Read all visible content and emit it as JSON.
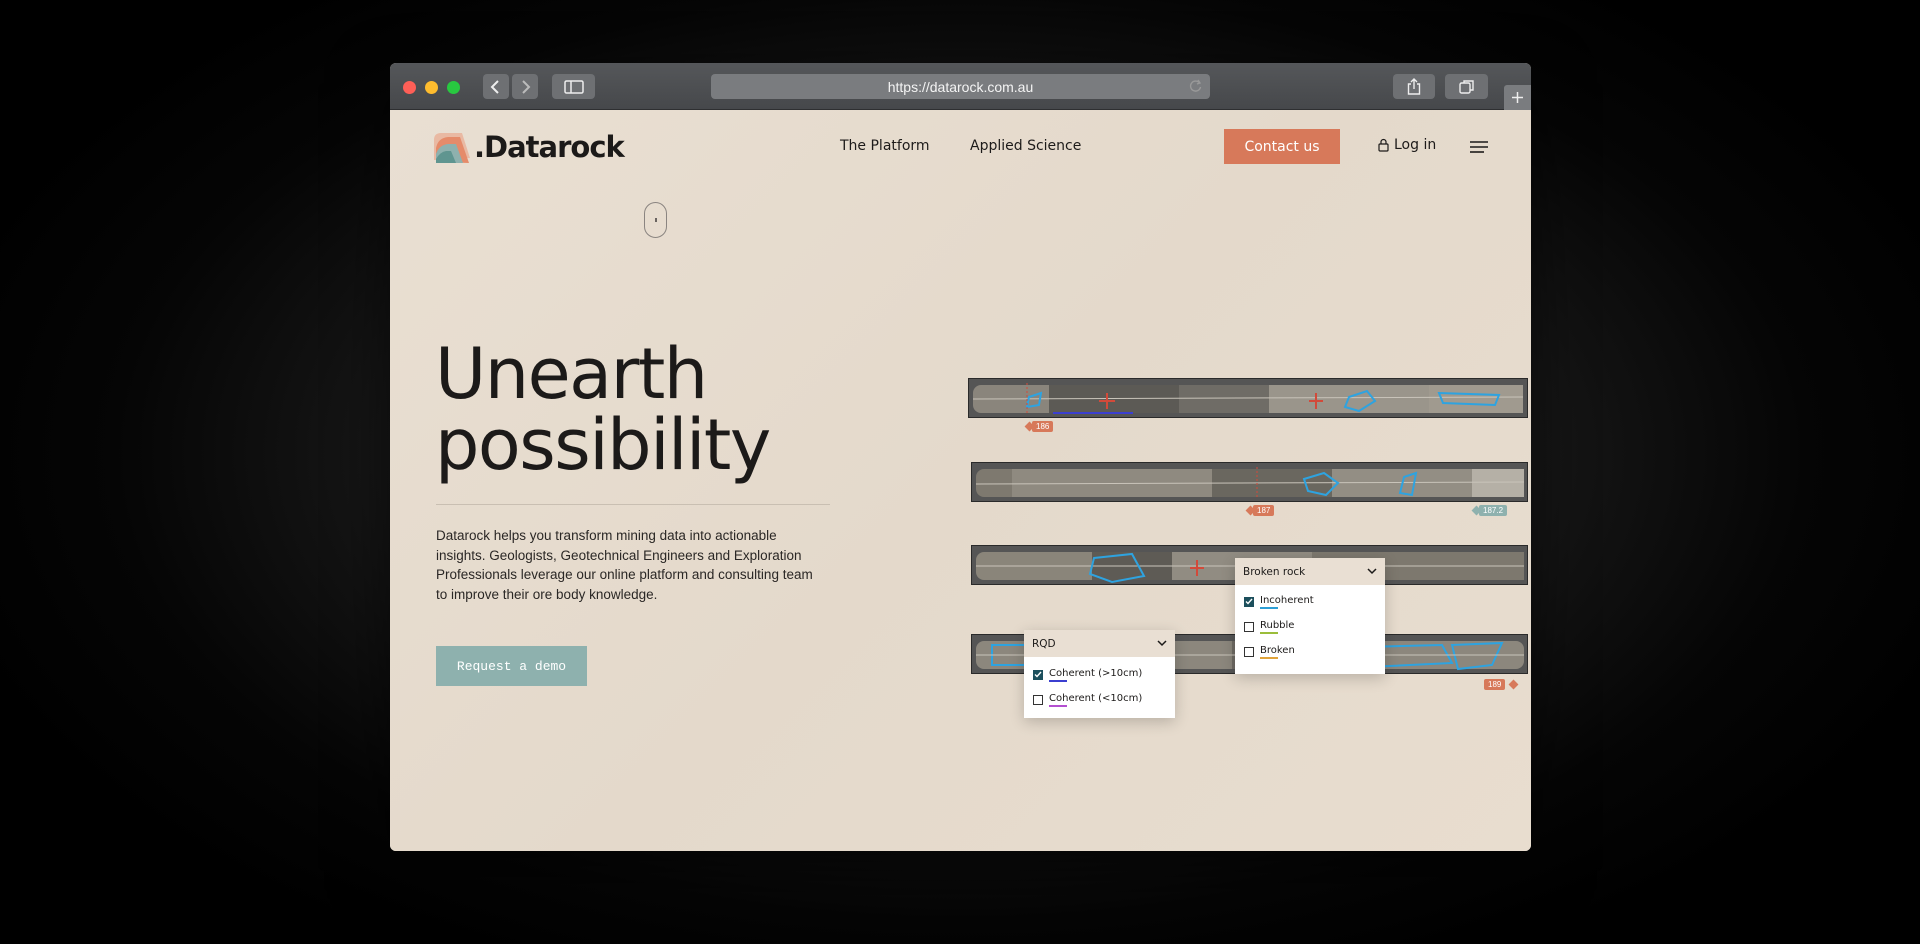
{
  "browser": {
    "url": "https://datarock.com.au"
  },
  "header": {
    "logo_text": ".Datarock",
    "nav": [
      "The Platform",
      "Applied Science"
    ],
    "contact_label": "Contact us",
    "login_label": "Log in"
  },
  "hero": {
    "headline_line1": "Unearth",
    "headline_line2": "possibility",
    "description": "Datarock helps you transform mining data into actionable insights. Geologists, Geotechnical Engineers and Exploration Professionals leverage our online platform and consulting team to improve their ore body knowledge.",
    "cta_label": "Request a demo"
  },
  "trays": {
    "markers": [
      "186",
      "187",
      "187.2",
      "189"
    ]
  },
  "popups": {
    "broken_rock": {
      "title": "Broken rock",
      "options": [
        {
          "label": "Incoherent",
          "checked": true,
          "color": "#2e9fd6"
        },
        {
          "label": "Rubble",
          "checked": false,
          "color": "#9bbd3a"
        },
        {
          "label": "Broken",
          "checked": false,
          "color": "#e0a33a"
        }
      ]
    },
    "rqd": {
      "title": "RQD",
      "options": [
        {
          "label": "Coherent (>10cm)",
          "checked": true,
          "color": "#3b3fd0"
        },
        {
          "label": "Coherent (<10cm)",
          "checked": false,
          "color": "#b34fd0"
        }
      ]
    }
  },
  "colors": {
    "accent": "#d7795a",
    "teal": "#8eb1ae",
    "background": "#e6dccf"
  }
}
